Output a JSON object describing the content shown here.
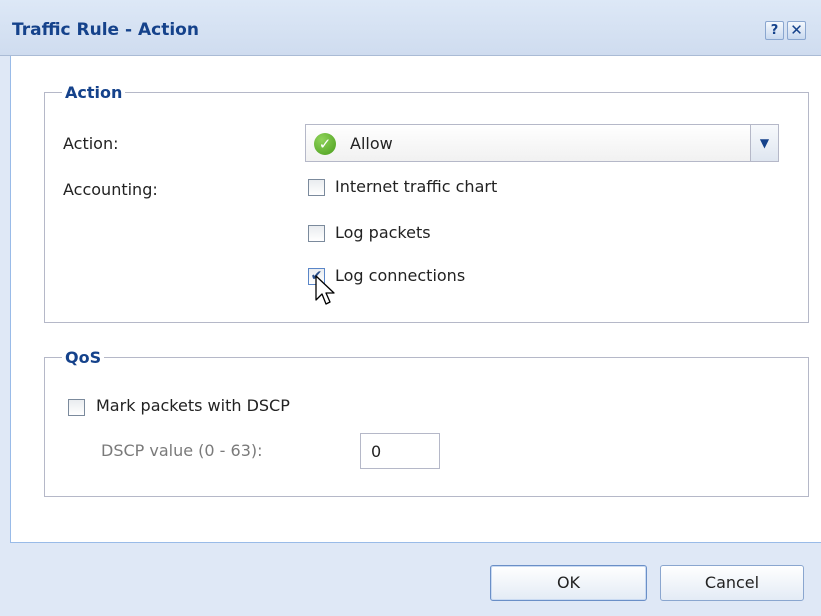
{
  "window": {
    "title": "Traffic Rule - Action",
    "help_symbol": "?",
    "close_symbol": "✕"
  },
  "action_group": {
    "legend": "Action",
    "action_label": "Action:",
    "action_value": "Allow",
    "action_icon": "green-check-circle-icon",
    "accounting_label": "Accounting:",
    "options": [
      {
        "label": "Internet traffic chart",
        "checked": false
      },
      {
        "label": "Log packets",
        "checked": false
      },
      {
        "label": "Log connections",
        "checked": true
      }
    ]
  },
  "qos_group": {
    "legend": "QoS",
    "mark_label": "Mark packets with DSCP",
    "mark_checked": false,
    "dscp_label": "DSCP value (0 - 63):",
    "dscp_value": "0"
  },
  "buttons": {
    "ok": "OK",
    "cancel": "Cancel"
  },
  "colors": {
    "title": "#15428b",
    "accent": "#99bbe8",
    "allow_icon": "#4a9d1c"
  }
}
